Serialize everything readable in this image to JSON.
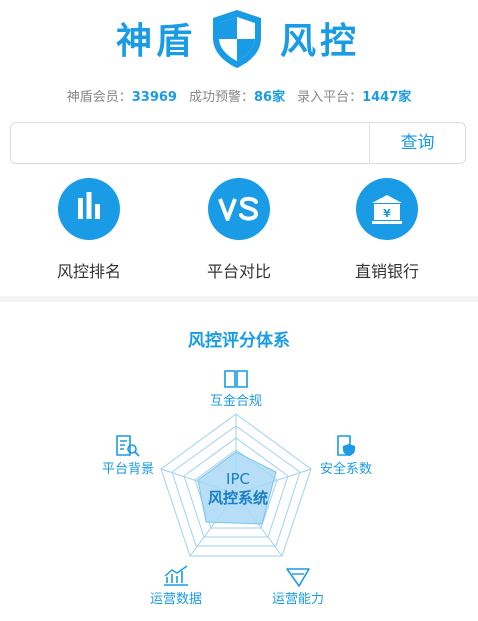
{
  "header": {
    "brand_left": "神盾",
    "brand_right": "风控",
    "shield_icon": "shield-icon",
    "accent_color": "#1a9be6"
  },
  "stats": {
    "members_label": "神盾会员：",
    "members_value": "33969",
    "warnings_label": "成功预警：",
    "warnings_value": "86家",
    "platforms_label": "录入平台：",
    "platforms_value": "1447家"
  },
  "search": {
    "placeholder": "",
    "value": "",
    "button_label": "查询"
  },
  "features": [
    {
      "label": "风控排名",
      "icon": "bar-chart-icon"
    },
    {
      "label": "平台对比",
      "icon": "vs-icon"
    },
    {
      "label": "直销银行",
      "icon": "bank-icon"
    }
  ],
  "risk_system": {
    "title": "风控评分体系",
    "center_line1": "IPC",
    "center_line2": "风控系统",
    "dimensions": [
      {
        "label": "互金合规",
        "icon": "book-icon"
      },
      {
        "label": "安全系数",
        "icon": "shield-document-icon"
      },
      {
        "label": "运营能力",
        "icon": "funnel-icon"
      },
      {
        "label": "运营数据",
        "icon": "line-chart-icon"
      },
      {
        "label": "平台背景",
        "icon": "search-document-icon"
      }
    ]
  }
}
